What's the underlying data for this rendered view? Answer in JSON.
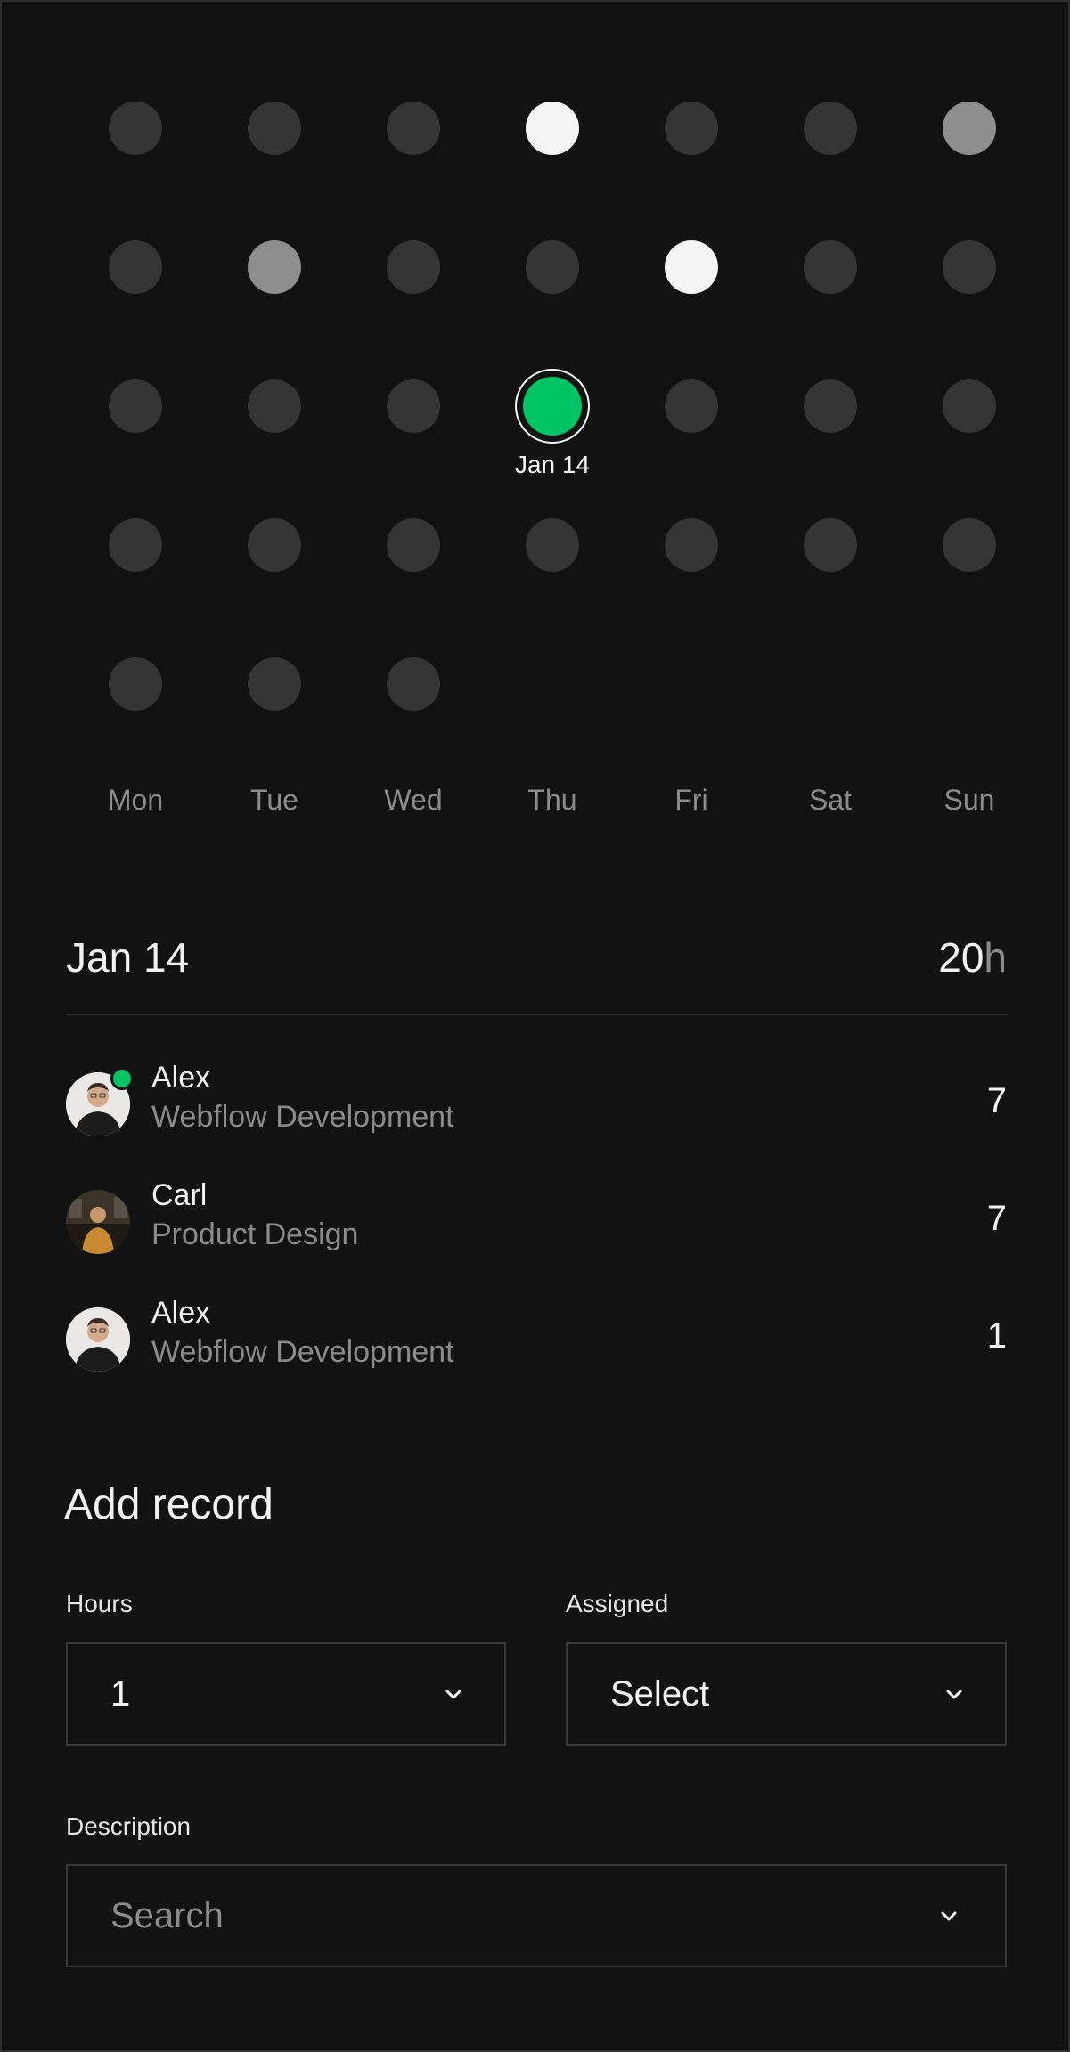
{
  "calendar": {
    "weeks": [
      [
        {
          "level": 1
        },
        {
          "level": 1
        },
        {
          "level": 1
        },
        {
          "level": 3
        },
        {
          "level": 1
        },
        {
          "level": 1
        },
        {
          "level": 2
        }
      ],
      [
        {
          "level": 1
        },
        {
          "level": 2
        },
        {
          "level": 1
        },
        {
          "level": 1
        },
        {
          "level": 3
        },
        {
          "level": 1
        },
        {
          "level": 1
        }
      ],
      [
        {
          "level": 1
        },
        {
          "level": 1
        },
        {
          "level": 1
        },
        {
          "level": 4,
          "selected": true,
          "label": "Jan 14"
        },
        {
          "level": 1
        },
        {
          "level": 1
        },
        {
          "level": 1
        }
      ],
      [
        {
          "level": 1
        },
        {
          "level": 1
        },
        {
          "level": 1
        },
        {
          "level": 1
        },
        {
          "level": 1
        },
        {
          "level": 1
        },
        {
          "level": 1
        }
      ],
      [
        {
          "level": 1
        },
        {
          "level": 1
        },
        {
          "level": 1
        },
        null,
        null,
        null,
        null
      ]
    ],
    "weekdays": [
      "Mon",
      "Tue",
      "Wed",
      "Thu",
      "Fri",
      "Sat",
      "Sun"
    ],
    "colors": {
      "empty": "#353535",
      "medium": "#8e8e8e",
      "high": "#f5f5f5",
      "selected": "#00c565"
    }
  },
  "day": {
    "title": "Jan 14",
    "total_value": "20",
    "total_unit": "h"
  },
  "records": [
    {
      "name": "Alex",
      "role": "Webflow Development",
      "hours": "7",
      "online": true,
      "avatar": "person-avatar"
    },
    {
      "name": "Carl",
      "role": "Product Design",
      "hours": "7",
      "online": false,
      "avatar": "person-avatar"
    },
    {
      "name": "Alex",
      "role": "Webflow Development",
      "hours": "1",
      "online": false,
      "avatar": "person-avatar"
    }
  ],
  "form": {
    "title": "Add record",
    "hours_label": "Hours",
    "hours_value": "1",
    "assigned_label": "Assigned",
    "assigned_placeholder": "Select",
    "description_label": "Description",
    "description_placeholder": "Search"
  },
  "icons": {
    "dropdown": "chevron-down-icon"
  }
}
